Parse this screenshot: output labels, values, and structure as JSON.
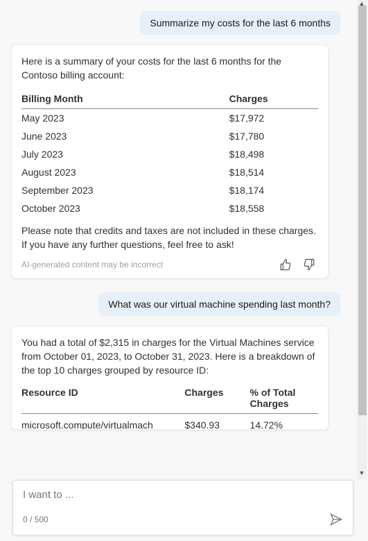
{
  "messages": {
    "user1": "Summarize my costs for the last 6 months",
    "ai1_intro": "Here is a summary of your costs for the last 6 months for the Contoso billing account:",
    "ai1_outro": "Please note that credits and taxes are not included in these charges. If you have any further questions, feel free to ask!",
    "user2": "What was our virtual machine spending last month?",
    "ai2_intro": "You had a total of $2,315 in charges for the Virtual Machines service from October 01, 2023, to October 31, 2023. Here is a breakdown of the top 10 charges grouped by resource ID:"
  },
  "cost_table": {
    "headers": {
      "month": "Billing Month",
      "charges": "Charges"
    },
    "rows": [
      {
        "month": "May 2023",
        "charges": "$17,972"
      },
      {
        "month": "June 2023",
        "charges": "$17,780"
      },
      {
        "month": "July 2023",
        "charges": "$18,498"
      },
      {
        "month": "August 2023",
        "charges": "$18,514"
      },
      {
        "month": "September 2023",
        "charges": "$18,174"
      },
      {
        "month": "October 2023",
        "charges": "$18,558"
      }
    ]
  },
  "resource_table": {
    "headers": {
      "id": "Resource ID",
      "charges": "Charges",
      "pct": "% of Total Charges"
    },
    "rows": [
      {
        "id": "microsoft.compute/virtualmach",
        "charges": "$340.93",
        "pct": "14.72%"
      }
    ]
  },
  "disclaimer": "AI-generated content may be incorrect",
  "input": {
    "placeholder": "I want to ...",
    "counter": "0 / 500"
  }
}
